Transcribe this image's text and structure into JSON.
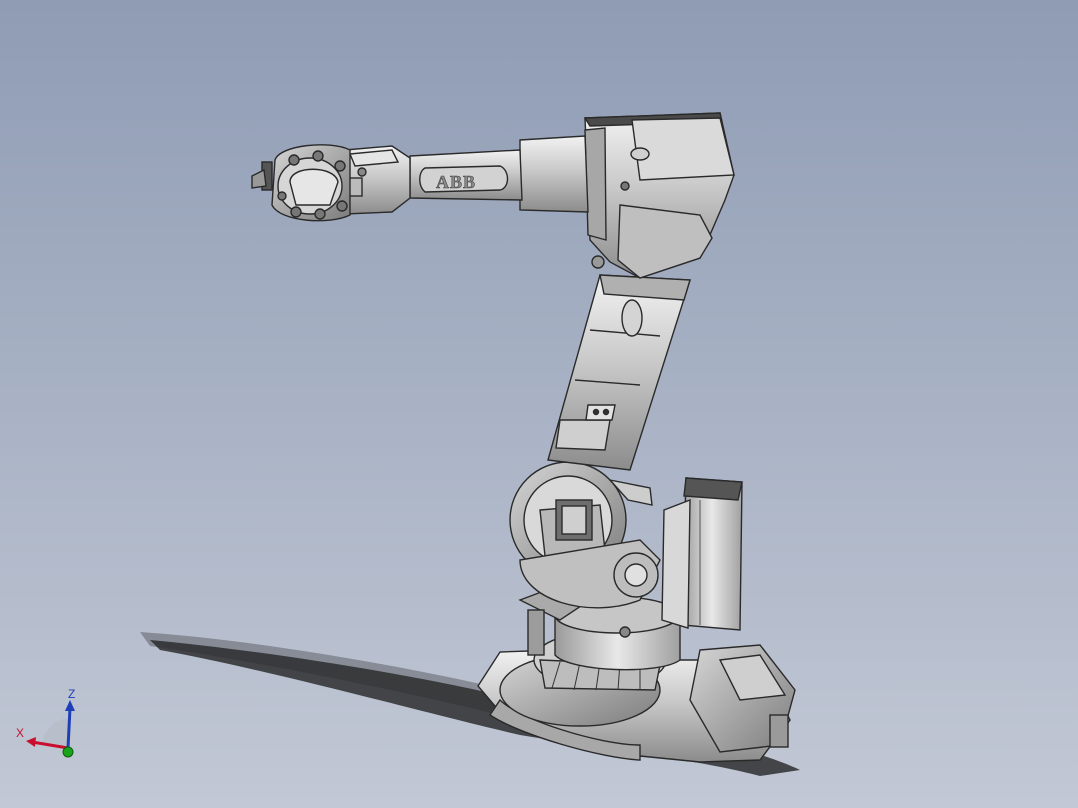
{
  "model_view": {
    "logo_text": "ABB",
    "colors": {
      "background_top": "#8f9cb4",
      "background_bottom": "#c2c8d5",
      "metal_light": "#e6e6e6",
      "metal_mid": "#bdbdbd",
      "metal_dark": "#8a8a8a",
      "edge": "#2a2a2a",
      "shadow": "#1a1a1a"
    }
  },
  "triad": {
    "x_label": "X",
    "z_label": "Z",
    "colors": {
      "x": "#c8102e",
      "z": "#1f3fb8",
      "y": "#1aa31a"
    }
  }
}
